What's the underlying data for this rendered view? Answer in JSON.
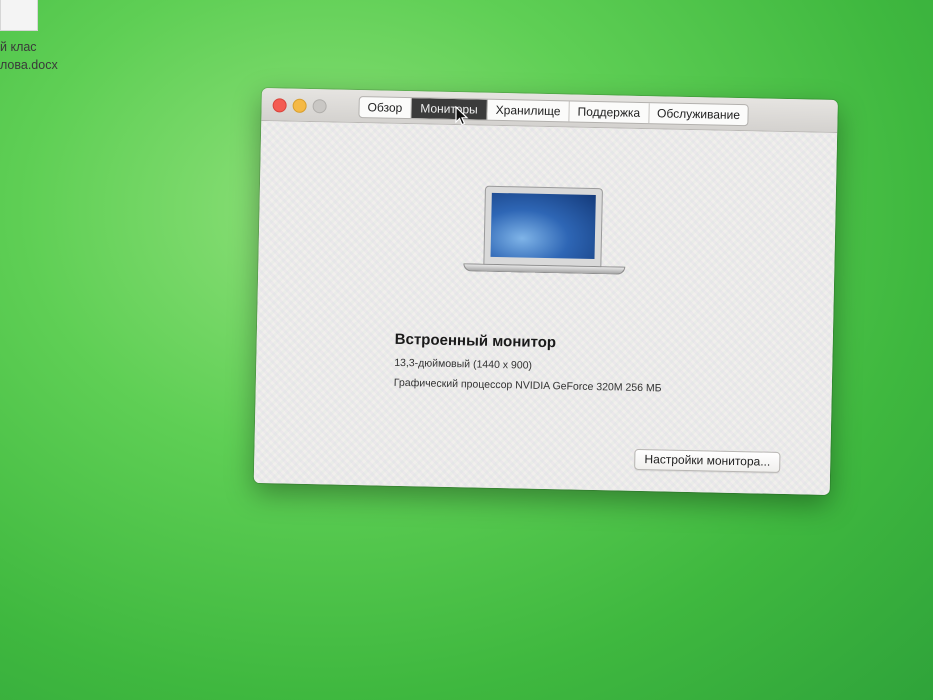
{
  "desktop": {
    "icon_label_line1": "й клас",
    "icon_label_line2": "лова.docx"
  },
  "window": {
    "tabs": [
      {
        "label": "Обзор",
        "active": false
      },
      {
        "label": "Мониторы",
        "active": true
      },
      {
        "label": "Хранилище",
        "active": false
      },
      {
        "label": "Поддержка",
        "active": false
      },
      {
        "label": "Обслуживание",
        "active": false
      }
    ],
    "display": {
      "title": "Встроенный монитор",
      "size_resolution": "13,3-дюймовый (1440 x 900)",
      "gpu": "Графический процессор NVIDIA GeForce 320M 256 МБ"
    },
    "settings_button_label": "Настройки монитора..."
  },
  "colors": {
    "desktop_bg": "#4fc44a",
    "close": "#f45b52",
    "minimize": "#f5b945",
    "active_tab": "#3b3b3b"
  },
  "icons": [
    "close-icon",
    "minimize-icon",
    "maximize-icon",
    "laptop-icon",
    "cursor-icon",
    "document-icon"
  ]
}
